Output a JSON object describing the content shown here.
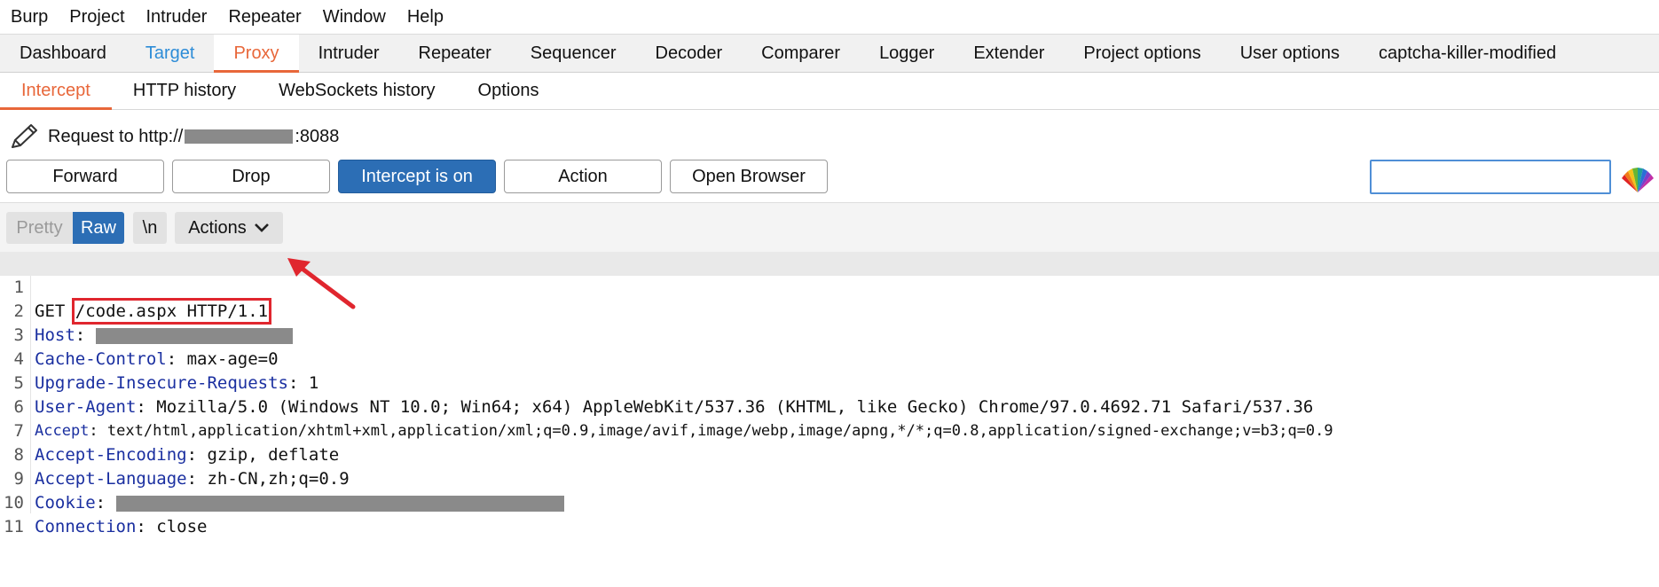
{
  "menubar": [
    "Burp",
    "Project",
    "Intruder",
    "Repeater",
    "Window",
    "Help"
  ],
  "main_tabs": [
    {
      "label": "Dashboard",
      "state": "normal"
    },
    {
      "label": "Target",
      "state": "highlight"
    },
    {
      "label": "Proxy",
      "state": "active"
    },
    {
      "label": "Intruder",
      "state": "normal"
    },
    {
      "label": "Repeater",
      "state": "normal"
    },
    {
      "label": "Sequencer",
      "state": "normal"
    },
    {
      "label": "Decoder",
      "state": "normal"
    },
    {
      "label": "Comparer",
      "state": "normal"
    },
    {
      "label": "Logger",
      "state": "normal"
    },
    {
      "label": "Extender",
      "state": "normal"
    },
    {
      "label": "Project options",
      "state": "normal"
    },
    {
      "label": "User options",
      "state": "normal"
    },
    {
      "label": "captcha-killer-modified",
      "state": "normal"
    }
  ],
  "sub_tabs": [
    {
      "label": "Intercept",
      "active": true
    },
    {
      "label": "HTTP history",
      "active": false
    },
    {
      "label": "WebSockets history",
      "active": false
    },
    {
      "label": "Options",
      "active": false
    }
  ],
  "request_info": {
    "prefix": "Request to http://",
    "suffix": ":8088"
  },
  "toolbar": {
    "forward": "Forward",
    "drop": "Drop",
    "intercept": "Intercept is on",
    "action": "Action",
    "open_browser": "Open Browser"
  },
  "search": {
    "value": ""
  },
  "editor_bar": {
    "pretty": "Pretty",
    "raw": "Raw",
    "newline": "\\n",
    "actions": "Actions"
  },
  "request": {
    "method": "GET",
    "path": "/code.aspx HTTP/1.1",
    "headers": [
      {
        "name": "Host",
        "value": ""
      },
      {
        "name": "Cache-Control",
        "value": "max-age=0"
      },
      {
        "name": "Upgrade-Insecure-Requests",
        "value": "1"
      },
      {
        "name": "User-Agent",
        "value": "Mozilla/5.0 (Windows NT 10.0; Win64; x64) AppleWebKit/537.36 (KHTML, like Gecko) Chrome/97.0.4692.71 Safari/537.36"
      },
      {
        "name": "Accept",
        "value": "text/html,application/xhtml+xml,application/xml;q=0.9,image/avif,image/webp,image/apng,*/*;q=0.8,application/signed-exchange;v=b3;q=0.9"
      },
      {
        "name": "Accept-Encoding",
        "value": "gzip, deflate"
      },
      {
        "name": "Accept-Language",
        "value": "zh-CN,zh;q=0.9"
      },
      {
        "name": "Cookie",
        "value": ""
      },
      {
        "name": "Connection",
        "value": "close"
      }
    ],
    "line_numbers": [
      "1",
      "2",
      "3",
      "4",
      "5",
      "6",
      "7",
      "8",
      "9",
      "10",
      "11"
    ]
  },
  "colors": {
    "accent": "#e8673a",
    "primary_button": "#2c6eb5",
    "annotation": "#e0262e",
    "header_name": "#1a2fa0"
  }
}
